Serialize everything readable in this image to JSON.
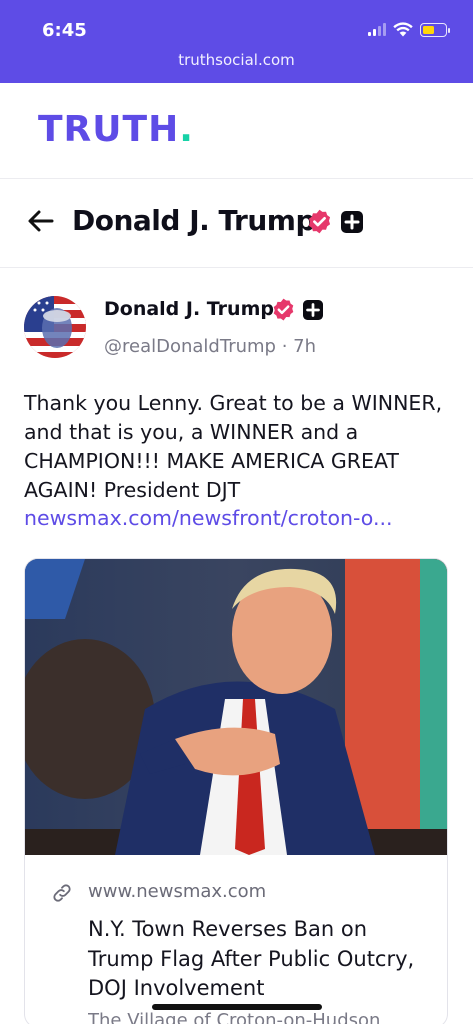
{
  "status_bar": {
    "time": "6:45",
    "url": "truthsocial.com",
    "battery_level": 0.45,
    "signal_bars": 2
  },
  "header": {
    "logo_text": "TRUTH",
    "logo_dot": ".",
    "brand_color": "#5e4ce6",
    "accent_color": "#17d2a7"
  },
  "profile": {
    "name": "Donald J. Trump",
    "verified_icon": "verified-badge-icon",
    "plus_icon": "plus-badge-icon"
  },
  "post": {
    "author": "Donald J. Trump",
    "handle": "@realDonaldTrump",
    "separator": "·",
    "time_ago": "7h",
    "text": "Thank you Lenny. Great to be a WINNER, and that is you, a WINNER and a CHAMPION!!! MAKE AMERICA GREAT AGAIN! President DJT",
    "link": "newsmax.com/newsfront/croton-o..."
  },
  "link_card": {
    "domain": "www.newsmax.com",
    "title": "N.Y. Town Reverses Ban on Trump Flag After Public Outcry, DOJ Involvement",
    "description": "The Village of Croton-on-Hudson"
  },
  "colors": {
    "verified": "#e6386b",
    "link": "#5e4ce6"
  }
}
